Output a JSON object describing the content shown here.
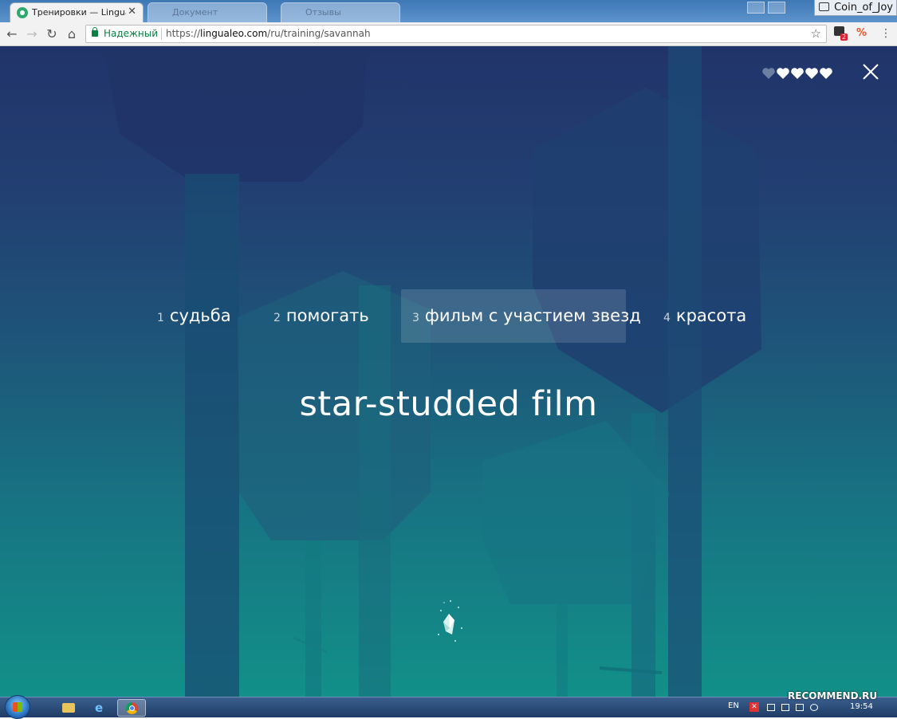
{
  "browser": {
    "active_tab": {
      "title": "Тренировки — LinguaLeo",
      "close_label": "✕"
    },
    "inactive_tabs": [
      {
        "title": "Документ"
      },
      {
        "title": "Отзывы"
      }
    ],
    "user": "Coin_of_Joy",
    "omnibox": {
      "secure_label": "Надежный",
      "url_scheme": "https://",
      "url_host": "lingualeo.com",
      "url_path": "/ru/training/savannah"
    },
    "extension_badge": "2"
  },
  "game": {
    "lives": {
      "total": 5,
      "remaining": 4
    },
    "answers": [
      {
        "num": "1",
        "text": "судьба",
        "selected": false
      },
      {
        "num": "2",
        "text": "помогать",
        "selected": false
      },
      {
        "num": "3",
        "text": "фильм с участием звезд",
        "selected": true
      },
      {
        "num": "4",
        "text": "красота",
        "selected": false
      }
    ],
    "word": "star-studded film"
  },
  "taskbar": {
    "lang": "EN",
    "time": "19:54"
  },
  "watermark": "RECOMMEND.RU",
  "colors": {
    "bg_top": "#21346a",
    "bg_bottom": "#129089",
    "heart_full": "#ffffff",
    "heart_lost": "#6b7fa0"
  }
}
